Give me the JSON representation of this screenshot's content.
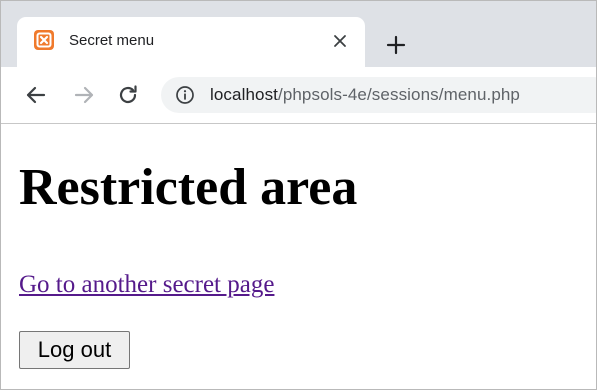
{
  "browser": {
    "tab": {
      "title": "Secret menu",
      "favicon": "xampp-icon",
      "favicon_color": "#f07a2c"
    },
    "toolbar": {
      "back_icon": "back-arrow-icon",
      "forward_icon": "forward-arrow-icon",
      "reload_icon": "reload-icon",
      "site_info_icon": "info-icon",
      "url_host": "localhost",
      "url_path": "/phpsols-4e/sessions/menu.php"
    }
  },
  "page": {
    "heading": "Restricted area",
    "link_text": "Go to another secret page",
    "link_color": "#551a8b",
    "logout_label": "Log out"
  }
}
